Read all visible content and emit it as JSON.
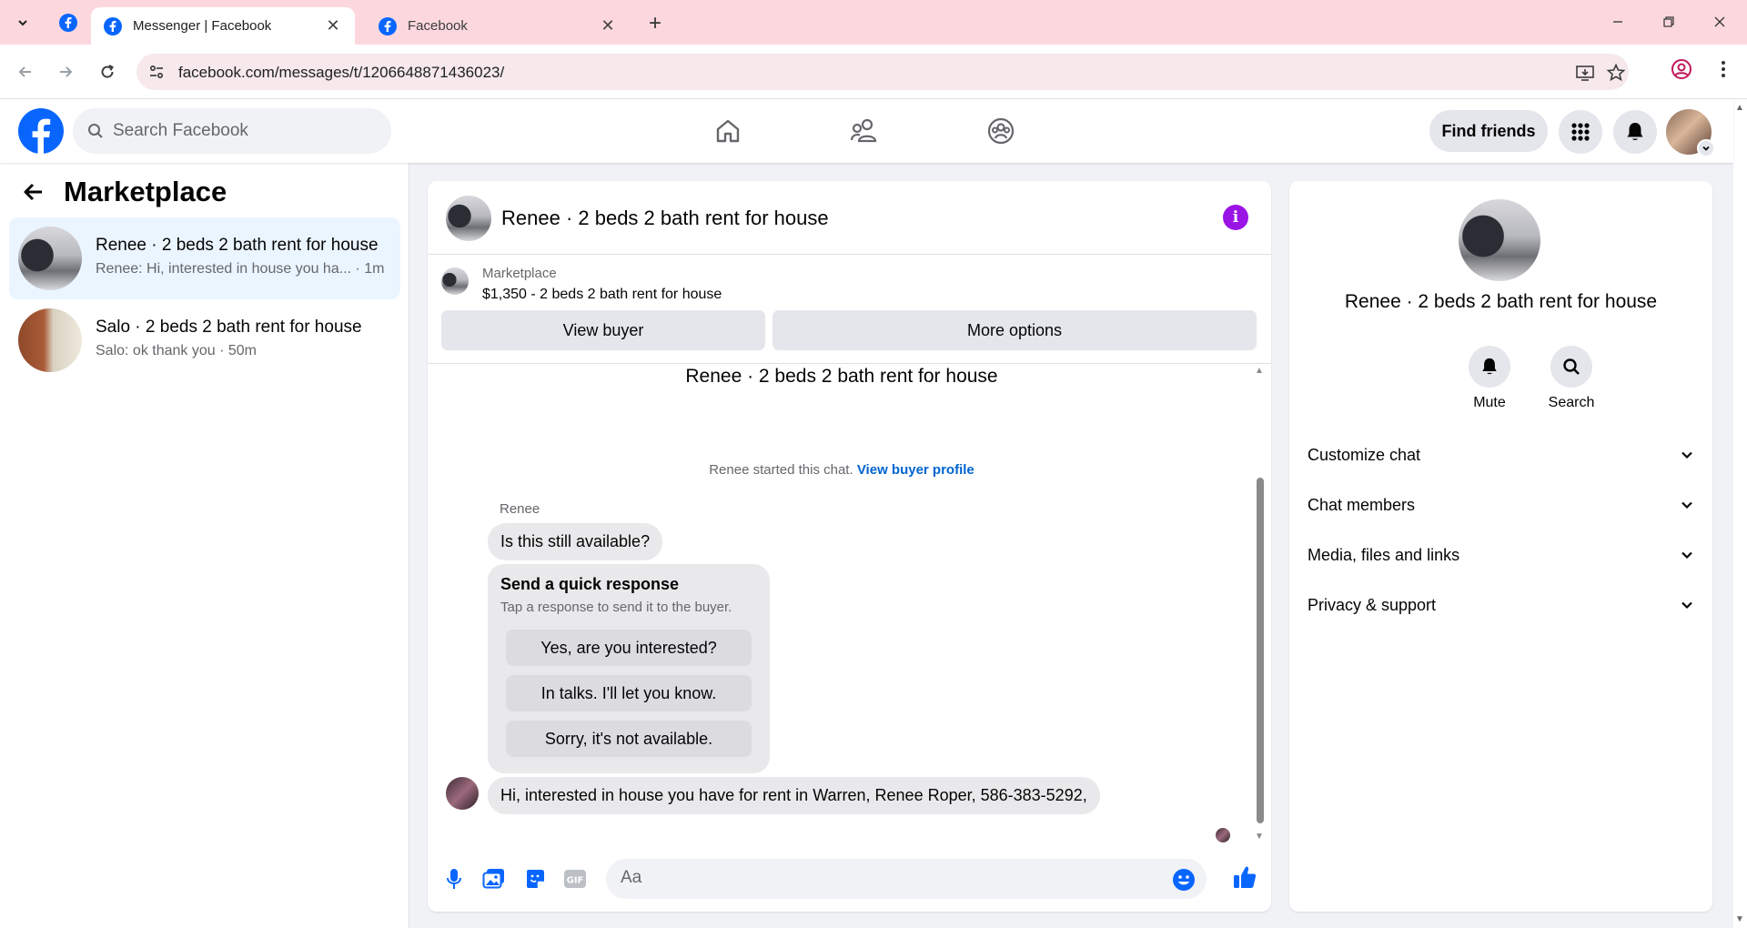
{
  "browser": {
    "tabs": [
      {
        "title": "Messenger | Facebook",
        "active": true
      },
      {
        "title": "Facebook",
        "active": false
      }
    ],
    "url": "facebook.com/messages/t/1206648871436023/",
    "close_glyph": "✕",
    "new_tab_glyph": "+"
  },
  "header": {
    "search_placeholder": "Search Facebook",
    "find_friends_label": "Find friends",
    "brand_color": "#0866ff"
  },
  "sidebar": {
    "title": "Marketplace",
    "conversations": [
      {
        "title": "Renee · 2 beds 2 bath rent for house",
        "preview": "Renee: Hi, interested in house you ha... · 1m",
        "selected": true
      },
      {
        "title": "Salo · 2 beds 2 bath rent for house",
        "preview": "Salo: ok thank you · 50m",
        "selected": false
      }
    ]
  },
  "chat": {
    "title": "Renee · 2 beds 2 bath rent for house",
    "listing": {
      "label": "Marketplace",
      "price_title": "$1,350 - 2 beds 2 bath rent for house",
      "view_buyer": "View buyer",
      "more_options": "More options"
    },
    "thread_title": "Renee · 2 beds 2 bath rent for house",
    "started_text": "Renee started this chat.",
    "view_buyer_profile": "View buyer profile",
    "sender_name": "Renee",
    "message_1": "Is this still available?",
    "quick_response": {
      "title": "Send a quick response",
      "subtitle": "Tap a response to send it to the buyer.",
      "options": [
        "Yes, are you interested?",
        "In talks. I'll let you know.",
        "Sorry, it's not available."
      ]
    },
    "message_2": "Hi, interested in house you have for rent in Warren, Renee Roper, 586-383-5292,",
    "composer_placeholder": "Aa",
    "accent_color": "#0866ff"
  },
  "details": {
    "title": "Renee · 2 beds 2 bath rent for house",
    "actions": [
      {
        "label": "Mute",
        "icon": "bell-icon"
      },
      {
        "label": "Search",
        "icon": "search-icon"
      }
    ],
    "sections": [
      "Customize chat",
      "Chat members",
      "Media, files and links",
      "Privacy & support"
    ]
  }
}
